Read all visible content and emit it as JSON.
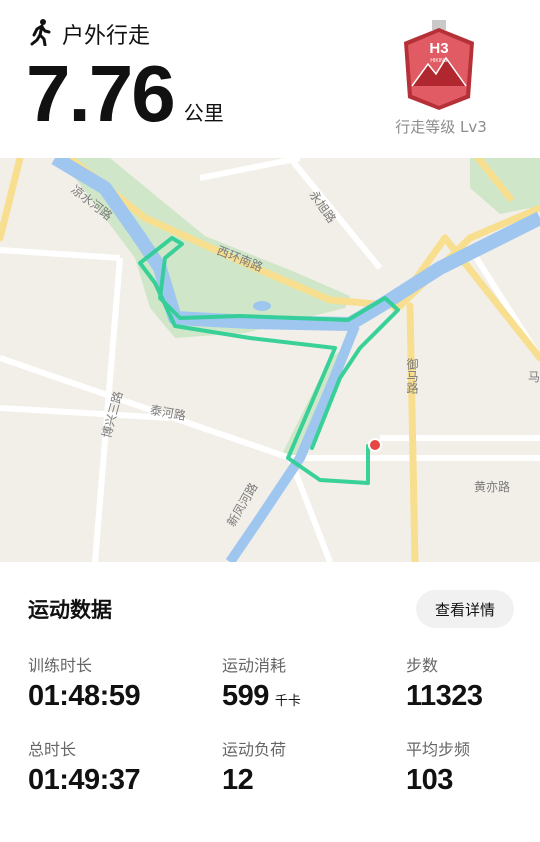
{
  "header": {
    "activity_label": "户外行走",
    "distance_value": "7.76",
    "distance_unit": "公里",
    "badge_text": "H3",
    "badge_subtext": "HIKING",
    "level_label": "行走等级 Lv3"
  },
  "map": {
    "road_labels": [
      "凉水河路",
      "西环南路",
      "永旭路",
      "御马路",
      "博兴三路",
      "泰河路",
      "新凤河路",
      "黄亦路",
      "马"
    ]
  },
  "stats": {
    "section_title": "运动数据",
    "detail_button": "查看详情",
    "items": [
      {
        "label": "训练时长",
        "value": "01:48:59",
        "unit": ""
      },
      {
        "label": "运动消耗",
        "value": "599",
        "unit": "千卡"
      },
      {
        "label": "步数",
        "value": "11323",
        "unit": ""
      },
      {
        "label": "总时长",
        "value": "01:49:37",
        "unit": ""
      },
      {
        "label": "运动负荷",
        "value": "12",
        "unit": ""
      },
      {
        "label": "平均步频",
        "value": "103",
        "unit": ""
      }
    ]
  },
  "colors": {
    "route": "#2fcf95",
    "river": "#9fc6ef",
    "park": "#cfe7c8",
    "road": "#f8df8f",
    "endpoint": "#e84545",
    "badge": "#d8414a"
  }
}
